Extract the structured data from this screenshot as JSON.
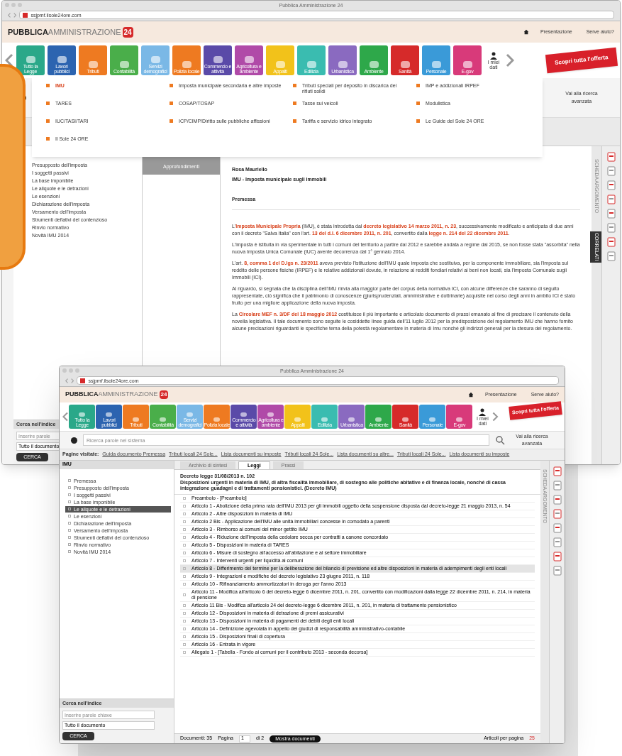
{
  "back_window": {
    "title": "Pubblica Amministrazione 24",
    "url": "ssjpmf.ilsole24ore.com",
    "brand": {
      "bold": "PUBBLICA",
      "light": "AMMINISTRAZIONE",
      "badge": "24"
    },
    "header_links": [
      "Presentazione",
      "Serve aiuto?"
    ],
    "tiles": [
      {
        "label": "Tutto la Legge",
        "color": "#2aa889"
      },
      {
        "label": "Lavori pubblici",
        "color": "#2c64b0"
      },
      {
        "label": "Tributi",
        "color": "#ee7a21"
      },
      {
        "label": "Contabilità",
        "color": "#4aae4a"
      },
      {
        "label": "Servizi demografici",
        "color": "#7ab8e6"
      },
      {
        "label": "Polizia locale",
        "color": "#ee7a21"
      },
      {
        "label": "Commercio e attività",
        "color": "#5a4aa8"
      },
      {
        "label": "Agricoltura e ambiente",
        "color": "#b04aa8"
      },
      {
        "label": "Appalti",
        "color": "#f2c21a"
      },
      {
        "label": "Edilizia",
        "color": "#3abcb0"
      },
      {
        "label": "Urbanistica",
        "color": "#8a6ac0"
      },
      {
        "label": "Ambiente",
        "color": "#2ea84a"
      },
      {
        "label": "Sanità",
        "color": "#d62a2a"
      },
      {
        "label": "Personale",
        "color": "#3a9ad8"
      },
      {
        "label": "E-gov",
        "color": "#d83a7a"
      }
    ],
    "user_label": "I miei dati",
    "promo": "Scopri tutta l'offerta",
    "menu": [
      {
        "label": "IMU",
        "selected": true
      },
      {
        "label": "Imposta municipale secondaria e altre imposte",
        "selected": false
      },
      {
        "label": "Tributi speciali per deposito in discarica dei rifiuti solidi",
        "selected": false
      },
      {
        "label": "IMP e addizionali IRPEF",
        "selected": false
      },
      {
        "label": "TARES",
        "selected": false
      },
      {
        "label": "COSAP/TOSAP",
        "selected": false
      },
      {
        "label": "Tasse sui veicoli",
        "selected": false
      },
      {
        "label": "Modulistica",
        "selected": false
      },
      {
        "label": "IUC/TASI/TARI",
        "selected": false
      },
      {
        "label": "ICP/CIMP/Diritto sulle pubbliche affissioni",
        "selected": false
      },
      {
        "label": "Tariffa e servizio idrico integrato",
        "selected": false
      },
      {
        "label": "Le Guide del Sole 24 ORE",
        "selected": false
      },
      {
        "label": "Il Sole 24 ORE",
        "selected": false
      }
    ],
    "advanced_link": "Vai alla ricerca avanzata",
    "tree": [
      "Presupposto dell'imposta",
      "I soggetti passivi",
      "La base imponibile",
      "Le aliquote e le detrazioni",
      "Le esenzioni",
      "Dichiarazione dell'imposta",
      "Versamento dell'imposta",
      "Strumenti deflativi del contenzioso",
      "Rinvio normativo",
      "Novità IMU 2014"
    ],
    "middle_tab": "Approfondimenti",
    "document": {
      "author": "Rosa Mauriello",
      "title": "IMU - Imposta municipale sugli immobili",
      "section": "Premessa",
      "paragraphs": [
        "L'**Imposta Municipale Propria** (IMU), è stata introdotta dal **decreto legislativo 14 marzo 2011, n. 23**, successivamente modificato e anticipata di due anni con il decreto \"Salva Italia\" con l'art. **13 del d.l. 6 dicembre 2011, n. 201**, convertito dalla **legge n. 214 del 22 dicembre 2011**.",
        "L'imposta è istituita in via sperimentale in tutti i comuni del territorio a partire dal 2012 e sarebbe andata a regime dal 2015, se non fosse stata \"assorbita\" nella nuova Imposta Unica Comunale (IUC) avente decorrenza dal 1° gennaio 2014.",
        "L'art. **8, comma 1 del D.lgs n. 23/2011** aveva previsto l'istituzione dell'IMU quale imposta che sostituiva, per la componente immobiliare, sia l'imposta sul reddito delle persone fisiche (IRPEF) e le relative addizionali dovute, in relazione ai redditi fondiari relativi ai beni non locati, sia l'imposta Comunale sugli Immobili (ICI).",
        "Al riguardo, si segnala che la disciplina dell'IMU rinvia alla maggior parte del corpus della normativa ICI, con alcune differenze che saranno di seguito rappresentate, ciò significa che il patrimonio di conoscenze (giurisprudenziali, amministrative e dottrinarie) acquisite nel corso degli anni in ambito ICI è stato fruito per una migliore applicazione della nuova imposta.",
        "La **Circolare MEF n. 3/DF del 18 maggio 2012** costituisce il più importante e articolato documento di prassi emanato al fine di precisare il contenuto della novella legislativa. Il tale documento sono seguite le cosiddette linee guida dell'11 luglio 2012 per la predisposizione del regolamento IMU che hanno fornito alcune precisazioni riguardanti le specifiche tema della potestà regolamentare in materia di Imu nonché gli indirizzi generali per la stesura del regolamento."
      ]
    },
    "side_tabs": [
      "SCHEDA ARGOMENTO",
      "CORRELATI"
    ],
    "search_panel": {
      "title": "Cerca nell'indice",
      "placeholder": "Inserire parole",
      "scope": "Tutto il documento",
      "button": "CERCA"
    }
  },
  "front_window": {
    "title": "Pubblica Amministrazione 24",
    "url": "ssjpmf.ilsole24ore.com",
    "brand": {
      "bold": "PUBBLICA",
      "light": "AMMINISTRAZIONE",
      "badge": "24"
    },
    "header_links": [
      "Presentazione",
      "Serve aiuto?"
    ],
    "tiles": [
      {
        "label": "Tutto la Legge",
        "color": "#2aa889"
      },
      {
        "label": "Lavori pubblici",
        "color": "#2c64b0"
      },
      {
        "label": "Tributi",
        "color": "#ee7a21"
      },
      {
        "label": "Contabilità",
        "color": "#4aae4a"
      },
      {
        "label": "Servizi demografici",
        "color": "#7ab8e6"
      },
      {
        "label": "Polizia locale",
        "color": "#ee7a21"
      },
      {
        "label": "Commercio e attività",
        "color": "#5a4aa8"
      },
      {
        "label": "Agricoltura e ambiente",
        "color": "#b04aa8"
      },
      {
        "label": "Appalti",
        "color": "#f2c21a"
      },
      {
        "label": "Edilizia",
        "color": "#3abcb0"
      },
      {
        "label": "Urbanistica",
        "color": "#8a6ac0"
      },
      {
        "label": "Ambiente",
        "color": "#2ea84a"
      },
      {
        "label": "Sanità",
        "color": "#d62a2a"
      },
      {
        "label": "Personale",
        "color": "#3a9ad8"
      },
      {
        "label": "E-gov",
        "color": "#d83a7a"
      }
    ],
    "user_label": "I miei dati",
    "promo": "Scopri tutta l'offerta",
    "search_placeholder": "Ricerca parole nel sistema",
    "advanced_link": "Vai alla ricerca avanzata",
    "breadcrumb_label": "Pagine visitate:",
    "breadcrumb": [
      "Guida documento Premessa",
      "Tributi locali 24 Sole...",
      "Lista documenti su imposte",
      "Tributi locali 24 Sole...",
      "Lista documenti su altre...",
      "Tributi locali 24 Sole...",
      "Lista documenti su imposte"
    ],
    "index_select": "IMU",
    "tree": [
      {
        "label": "Premessa",
        "selected": false
      },
      {
        "label": "Presupposto dell'imposta",
        "selected": false
      },
      {
        "label": "I soggetti passivi",
        "selected": false
      },
      {
        "label": "La base imponibile",
        "selected": false
      },
      {
        "label": "Le aliquote e le detrazioni",
        "selected": true
      },
      {
        "label": "Le esenzioni",
        "selected": false
      },
      {
        "label": "Dichiarazione dell'imposta",
        "selected": false
      },
      {
        "label": "Versamento dell'imposta",
        "selected": false
      },
      {
        "label": "Strumenti deflativi del contenzioso",
        "selected": false
      },
      {
        "label": "Rinvio normativo",
        "selected": false
      },
      {
        "label": "Novità IMU 2014",
        "selected": false
      }
    ],
    "tabs": [
      {
        "label": "Archivio di sintesi",
        "selected": false
      },
      {
        "label": "Leggi",
        "selected": true
      },
      {
        "label": "Prassi",
        "selected": false
      }
    ],
    "law_title": "Decreto legge 31/08/2013 n. 102",
    "law_subtitle": "Disposizioni urgenti in materia di IMU, di altra fiscalità immobiliare, di sostegno alle politiche abitative e di finanza locale, nonché di cassa integrazione guadagni e di trattamenti pensionistici. (Decreto IMU)",
    "articles": [
      {
        "label": "Preambolo - [Preambolo]",
        "selected": false
      },
      {
        "label": "Articolo 1 - Abolizione della prima rata dell'IMU 2013 per gli immobili oggetto della sospensione disposta dal decreto-legge 21 maggio 2013, n. 54",
        "selected": false
      },
      {
        "label": "Articolo 2 - Altre disposizioni in materia di IMU",
        "selected": false
      },
      {
        "label": "Articolo 2 Bis - Applicazione dell'IMU alle unità immobiliari concesse in comodato a parenti",
        "selected": false
      },
      {
        "label": "Articolo 3 - Rimborso ai comuni del minor gettito IMU",
        "selected": false
      },
      {
        "label": "Articolo 4 - Riduzione dell'imposta della cedolare secca per contratti a canone concordato",
        "selected": false
      },
      {
        "label": "Articolo 5 - Disposizioni in materia di TARES",
        "selected": false
      },
      {
        "label": "Articolo 6 - Misure di sostegno all'accesso all'abitazione e al settore immobiliare",
        "selected": false
      },
      {
        "label": "Articolo 7 - Interventi urgenti per liquidità ai comuni",
        "selected": false
      },
      {
        "label": "Articolo 8 - Differimento del termine per la deliberazione del bilancio di previsione ed altre disposizioni in materia di adempimenti degli enti locali",
        "selected": true
      },
      {
        "label": "Articolo 9 - Integrazioni e modifiche del decreto legislativo 23 giugno 2011, n. 118",
        "selected": false
      },
      {
        "label": "Articolo 10 - Rifinanziamento ammortizzatori in deroga per l'anno 2013",
        "selected": false
      },
      {
        "label": "Articolo 11 - Modifica all'articolo 6 del decreto-legge 6 dicembre 2011, n. 201, convertito con modificazioni dalla legge 22 dicembre 2011, n. 214, in materia di pensione",
        "selected": false
      },
      {
        "label": "Articolo 11 Bis - Modifica all'articolo 24 del decreto-legge 6 dicembre 2011, n. 201, in materia di trattamento pensionistico",
        "selected": false
      },
      {
        "label": "Articolo 12 - Disposizioni in materia di detrazione di premi assicurativi",
        "selected": false
      },
      {
        "label": "Articolo 13 - Disposizioni in materia di pagamenti dei debiti degli enti locali",
        "selected": false
      },
      {
        "label": "Articolo 14 - Definizione agevolata in appello dei giudizi di responsabilità amministrativo-contabile",
        "selected": false
      },
      {
        "label": "Articolo 15 - Disposizioni finali di copertura",
        "selected": false
      },
      {
        "label": "Articolo 16 - Entrata in vigore",
        "selected": false
      },
      {
        "label": "Allegato 1 - [Tabella - Fondo ai comuni per il contributo 2013 - seconda decorsa]",
        "selected": false
      }
    ],
    "side_tab": "SCHEDA ARGOMENTO",
    "footer": {
      "count": "Documenti: 35",
      "page_label": "Pagina",
      "page": "1",
      "of": "di 2",
      "show_button": "Mostra documenti",
      "per_page_label": "Articoli per pagina",
      "per_page": "25"
    },
    "search_panel": {
      "title": "Cerca nell'indice",
      "placeholder": "Inserire parole chiave",
      "scope": "Tutto il documento",
      "button": "CERCA"
    }
  }
}
